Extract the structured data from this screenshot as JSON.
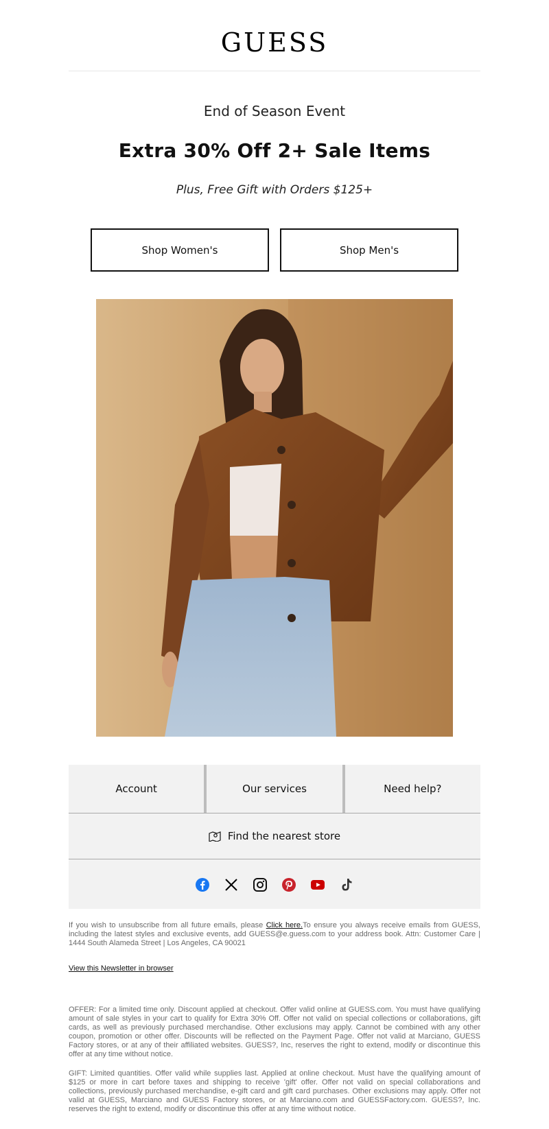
{
  "brand": {
    "logo": "GUESS"
  },
  "hero": {
    "eyebrow": "End of Season Event",
    "headline": "Extra 30% Off 2+ Sale Items",
    "subline": "Plus, Free Gift with Orders $125+"
  },
  "cta": {
    "women_label": "Shop Women's",
    "men_label": "Shop Men's"
  },
  "nav": {
    "account": "Account",
    "services": "Our services",
    "help": "Need help?",
    "store": "Find the nearest store"
  },
  "social": {
    "icons": [
      "facebook-icon",
      "x-icon",
      "instagram-icon",
      "pinterest-icon",
      "youtube-icon",
      "tiktok-icon"
    ],
    "colors": {
      "facebook": "#1877f2",
      "x": "#000000",
      "instagram": "#111111",
      "pinterest": "#c8232c",
      "youtube": "#cc0000",
      "tiktok": "#333333"
    }
  },
  "footer": {
    "unsub_prefix": "If you wish to unsubscribe from all future emails, please ",
    "unsub_link": "Click here.",
    "unsub_suffix": "To ensure you always receive emails from GUESS, including the latest styles and exclusive events, add GUESS@e.guess.com to your address book. Attn: Customer Care | 1444 South Alameda Street | Los Angeles, CA 90021",
    "browser_link": "View this Newsletter in browser",
    "offer": "OFFER: For a limited time only. Discount applied at checkout. Offer valid online at GUESS.com. You must have qualifying amount of sale styles in your cart to qualify for Extra 30% Off. Offer not valid on special collections or collaborations, gift cards, as well as previously purchased merchandise. Other exclusions may apply. Cannot be combined with any other coupon, promotion or other offer. Discounts will be reflected on the Payment Page. Offer not valid at Marciano, GUESS Factory stores, or at any of their affiliated websites. GUESS?, Inc, reserves the right to extend, modify or discontinue this offer at any time without notice.",
    "gift": "GIFT: Limited quantities. Offer valid while supplies last. Applied at online checkout. Must have the qualifying amount of $125 or more in cart before taxes and shipping to receive 'gift' offer. Offer not valid on special collaborations and collections, previously purchased merchandise, e-gift card and gift card purchases. Other exclusions may apply. Offer not valid at GUESS, Marciano and GUESS Factory stores, or at Marciano.com and GUESSFactory.com. GUESS?, Inc. reserves the right to extend, modify or discontinue this offer at any time without notice."
  }
}
